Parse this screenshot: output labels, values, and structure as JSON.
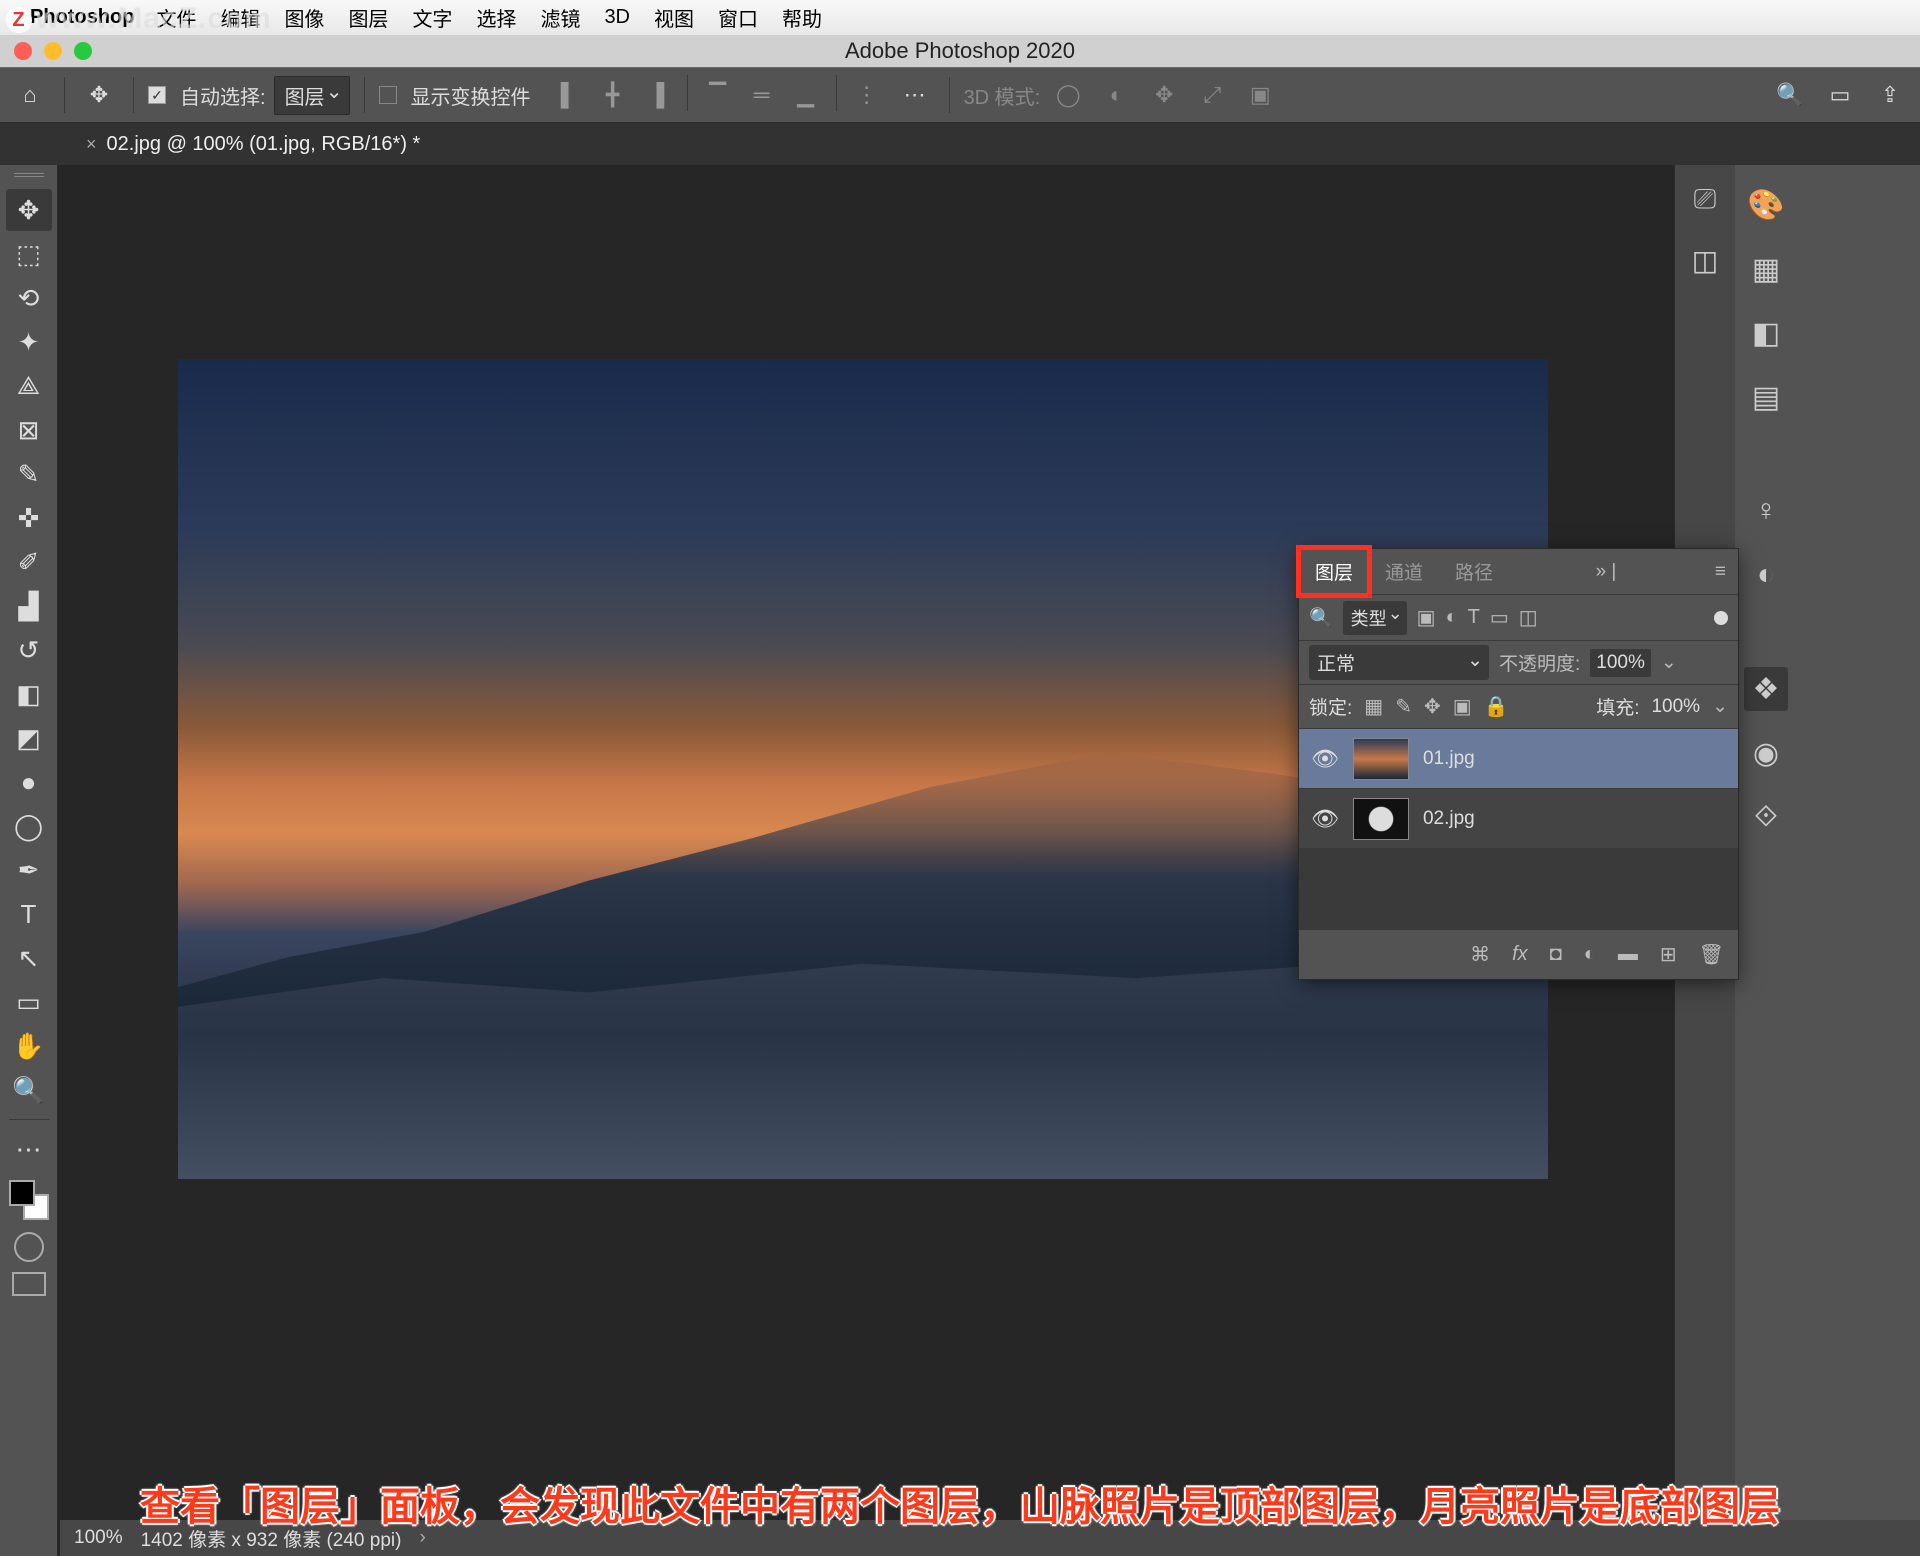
{
  "watermark": "www.MacZ.com",
  "mac_menu": {
    "app": "Photoshop",
    "items": [
      "文件",
      "编辑",
      "图像",
      "图层",
      "文字",
      "选择",
      "滤镜",
      "3D",
      "视图",
      "窗口",
      "帮助"
    ]
  },
  "window_title": "Adobe Photoshop 2020",
  "options_bar": {
    "auto_select_label": "自动选择:",
    "auto_select_checked": true,
    "auto_select_target": "图层",
    "show_transform_label": "显示变换控件",
    "show_transform_checked": false,
    "threed_label": "3D 模式:"
  },
  "doc_tab": {
    "title": "02.jpg @ 100% (01.jpg, RGB/16*) *"
  },
  "layers_panel": {
    "tabs": {
      "layers": "图层",
      "channels": "通道",
      "paths": "路径"
    },
    "filter_label": "类型",
    "blend_mode": "正常",
    "opacity_label": "不透明度:",
    "opacity_value": "100%",
    "lock_label": "锁定:",
    "fill_label": "填充:",
    "fill_value": "100%",
    "layers": [
      {
        "name": "01.jpg",
        "visible": true,
        "selected": true,
        "thumb": "sunset"
      },
      {
        "name": "02.jpg",
        "visible": true,
        "selected": false,
        "thumb": "moon"
      }
    ]
  },
  "status_bar": {
    "zoom": "100%",
    "info": "1402 像素 x 932 像素 (240 ppi)"
  },
  "annotation": "查看「图层」面板，会发现此文件中有两个图层，山脉照片是顶部图层，月亮照片是底部图层"
}
